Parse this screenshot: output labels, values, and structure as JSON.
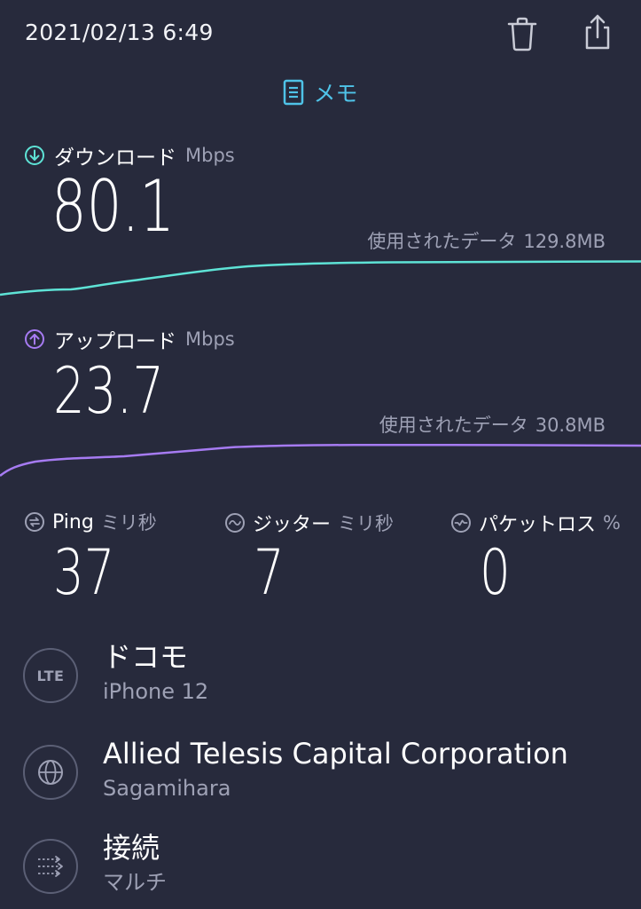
{
  "timestamp": "2021/02/13 6:49",
  "toolbar": {
    "trash_icon": "trash-icon",
    "share_icon": "share-icon"
  },
  "memo": {
    "label": "メモ",
    "icon": "memo-icon"
  },
  "download": {
    "label": "ダウンロード",
    "unit": "Mbps",
    "value": "80.1",
    "data_used_label": "使用されたデータ",
    "data_used_value": "129.8MB",
    "color": "#5ee3d6"
  },
  "upload": {
    "label": "アップロード",
    "unit": "Mbps",
    "value": "23.7",
    "data_used_label": "使用されたデータ",
    "data_used_value": "30.8MB",
    "color": "#a67bf2"
  },
  "metrics": {
    "ping": {
      "label": "Ping",
      "unit": "ミリ秒",
      "value": "37"
    },
    "jitter": {
      "label": "ジッター",
      "unit": "ミリ秒",
      "value": "7"
    },
    "loss": {
      "label": "パケットロス",
      "unit": "%",
      "value": "0"
    }
  },
  "carrier": {
    "badge": "LTE",
    "name": "ドコモ",
    "device": "iPhone 12"
  },
  "server": {
    "icon": "globe-icon",
    "name": "Allied Telesis Capital Corporation",
    "location": "Sagamihara"
  },
  "connection": {
    "icon": "connections-icon",
    "label": "接続",
    "value": "マルチ"
  },
  "colors": {
    "background": "#272a3c",
    "accent_memo": "#4fc3e8",
    "secondary_text": "#9ea1b5"
  }
}
